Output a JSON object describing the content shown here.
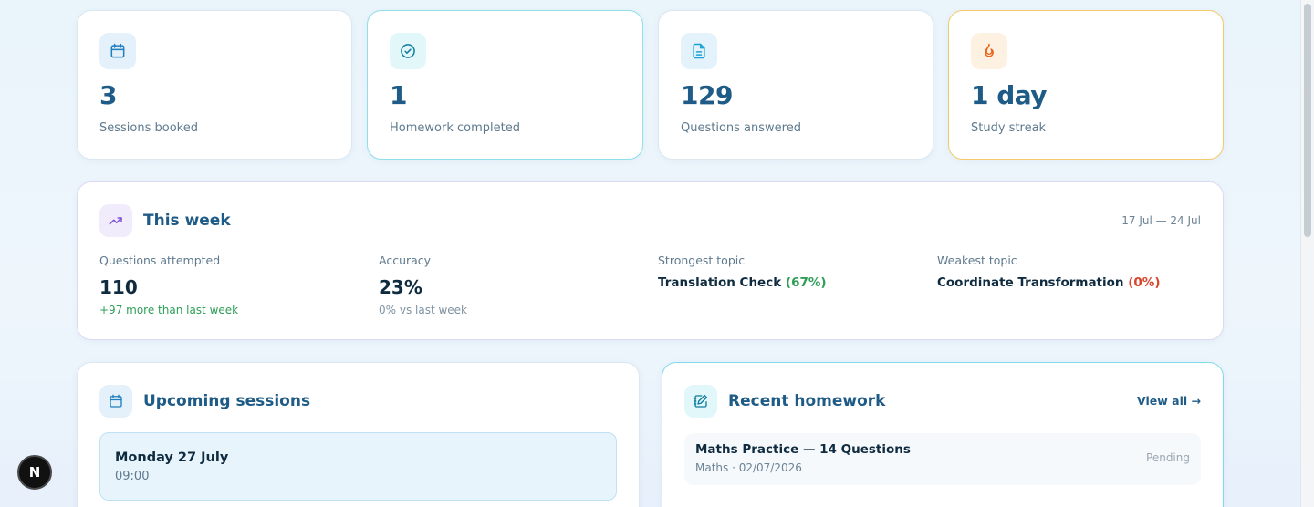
{
  "stats": [
    {
      "value": "3",
      "label": "Sessions booked",
      "icon": "calendar-icon",
      "accent": "#1e7fbf"
    },
    {
      "value": "1",
      "label": "Homework completed",
      "icon": "check-circle-icon",
      "accent": "#0aa6c2"
    },
    {
      "value": "129",
      "label": "Questions answered",
      "icon": "document-icon",
      "accent": "#1ba3d6"
    },
    {
      "value": "1 day",
      "label": "Study streak",
      "icon": "flame-icon",
      "accent": "#e8651a"
    }
  ],
  "week": {
    "title": "This week",
    "range": "17 Jul — 24 Jul",
    "questions_label": "Questions attempted",
    "questions_value": "110",
    "questions_sub": "+97 more than last week",
    "accuracy_label": "Accuracy",
    "accuracy_value": "23%",
    "accuracy_sub": "0% vs last week",
    "strongest_label": "Strongest topic",
    "strongest_topic": "Translation Check",
    "strongest_pct": "(67%)",
    "weakest_label": "Weakest topic",
    "weakest_topic": "Coordinate Transformation",
    "weakest_pct": "(0%)"
  },
  "upcoming": {
    "title": "Upcoming sessions",
    "items": [
      {
        "day": "Monday 27 July",
        "time": "09:00"
      }
    ]
  },
  "homework": {
    "title": "Recent homework",
    "view_all": "View all →",
    "items": [
      {
        "title": "Maths Practice — 14 Questions",
        "meta": "Maths · 02/07/2026",
        "status": "Pending"
      }
    ]
  },
  "badge": {
    "letter": "N"
  },
  "colors": {
    "brand": "#1e5b86",
    "positive": "#2e9e57",
    "negative": "#d9442b",
    "streak_border": "#f5c86a",
    "homework_border": "#7fdcea"
  }
}
